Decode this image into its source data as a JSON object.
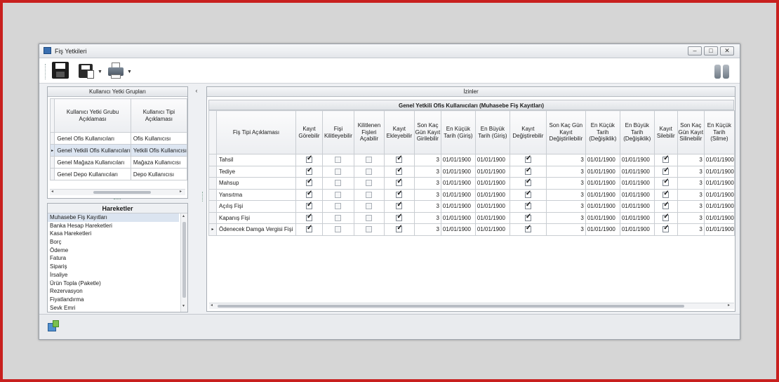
{
  "window": {
    "title": "Fiş Yetkileri"
  },
  "window_buttons": {
    "minimize": "–",
    "maximize": "□",
    "close": "✕"
  },
  "left_panel": {
    "caption": "Kullanıcı Yetki Grupları",
    "columns": [
      "Kullanıcı Yetki Grubu Açıklaması",
      "Kullanıcı Tipi Açıklaması"
    ],
    "rows": [
      {
        "group": "Genel Ofis Kullanıcıları",
        "type": "Ofis Kullanıcısı",
        "selected": false
      },
      {
        "group": "Genel Yetkili Ofis Kullanıcıları",
        "type": "Yetkili Ofis Kullanıcısı",
        "selected": true
      },
      {
        "group": "Genel Mağaza Kullanıcıları",
        "type": "Mağaza Kullanıcısı",
        "selected": false
      },
      {
        "group": "Genel Depo Kullanıcıları",
        "type": "Depo Kullanıcısı",
        "selected": false
      }
    ]
  },
  "hareketler": {
    "caption": "Hareketler",
    "items": [
      "Muhasebe Fiş Kayıtları",
      "Banka Hesap Hareketleri",
      "Kasa Hareketleri",
      "Borç",
      "Ödeme",
      "Fatura",
      "Sipariş",
      "İrsaliye",
      "Ürün Topla (Paketle)",
      "Rezervasyon",
      "Fiyatlandırma",
      "Sevk Emri"
    ],
    "selected_index": 0
  },
  "right_panel": {
    "caption": "İzinler",
    "group_caption": "Genel Yetkili Ofis Kullanıcıları (Muhasebe Fiş Kayıtları)",
    "columns": [
      "Fiş Tipi Açıklaması",
      "Kayıt Görebilir",
      "Fişi Kilitleyebilir",
      "Kilitlenen Fişleri Açabilir",
      "Kayıt Ekleyebilir",
      "Son Kaç Gün Kayıt Girilebilir",
      "En Küçük Tarih (Giriş)",
      "En Büyük Tarih (Giriş)",
      "Kayıt Değiştirebilir",
      "Son Kaç Gün Kayıt Değiştirilebilir",
      "En Küçük Tarih (Değişiklik)",
      "En Büyük Tarih (Değişiklik)",
      "Kayıt Silebilir",
      "Son Kaç Gün Kayıt Silinebilir",
      "En Küçük Tarih (Silme)"
    ],
    "rows": [
      {
        "name": "Tahsil",
        "c1": true,
        "c2": false,
        "c3": false,
        "c4": true,
        "days1": "3",
        "d1": "01/01/1900",
        "d2": "01/01/1900",
        "c5": true,
        "days2": "3",
        "d3": "01/01/1900",
        "d4": "01/01/1900",
        "c6": true,
        "days3": "3",
        "d5": "01/01/1900",
        "current": false
      },
      {
        "name": "Tediye",
        "c1": true,
        "c2": false,
        "c3": false,
        "c4": true,
        "days1": "3",
        "d1": "01/01/1900",
        "d2": "01/01/1900",
        "c5": true,
        "days2": "3",
        "d3": "01/01/1900",
        "d4": "01/01/1900",
        "c6": true,
        "days3": "3",
        "d5": "01/01/1900",
        "current": false
      },
      {
        "name": "Mahsup",
        "c1": true,
        "c2": false,
        "c3": false,
        "c4": true,
        "days1": "3",
        "d1": "01/01/1900",
        "d2": "01/01/1900",
        "c5": true,
        "days2": "3",
        "d3": "01/01/1900",
        "d4": "01/01/1900",
        "c6": true,
        "days3": "3",
        "d5": "01/01/1900",
        "current": false
      },
      {
        "name": "Yansıtma",
        "c1": true,
        "c2": false,
        "c3": false,
        "c4": true,
        "days1": "3",
        "d1": "01/01/1900",
        "d2": "01/01/1900",
        "c5": true,
        "days2": "3",
        "d3": "01/01/1900",
        "d4": "01/01/1900",
        "c6": true,
        "days3": "3",
        "d5": "01/01/1900",
        "current": false
      },
      {
        "name": "Açılış Fişi",
        "c1": true,
        "c2": false,
        "c3": false,
        "c4": true,
        "days1": "3",
        "d1": "01/01/1900",
        "d2": "01/01/1900",
        "c5": true,
        "days2": "3",
        "d3": "01/01/1900",
        "d4": "01/01/1900",
        "c6": true,
        "days3": "3",
        "d5": "01/01/1900",
        "current": false
      },
      {
        "name": "Kapanış Fişi",
        "c1": true,
        "c2": false,
        "c3": false,
        "c4": true,
        "days1": "3",
        "d1": "01/01/1900",
        "d2": "01/01/1900",
        "c5": true,
        "days2": "3",
        "d3": "01/01/1900",
        "d4": "01/01/1900",
        "c6": true,
        "days3": "3",
        "d5": "01/01/1900",
        "current": false
      },
      {
        "name": "Ödenecek Damga Vergisi Fişi",
        "c1": true,
        "c2": false,
        "c3": false,
        "c4": true,
        "days1": "3",
        "d1": "01/01/1900",
        "d2": "01/01/1900",
        "c5": true,
        "days2": "3",
        "d3": "01/01/1900",
        "d4": "01/01/1900",
        "c6": true,
        "days3": "3",
        "d5": "01/01/1900",
        "current": true
      }
    ]
  },
  "icons": {
    "toolbar": [
      "save-icon",
      "save-as-icon",
      "print-icon",
      "binoculars-icon"
    ],
    "status": "export-icon",
    "row_indicator": "▸"
  },
  "colors": {
    "frame": "#c8201e",
    "selection": "#dde6f2"
  }
}
